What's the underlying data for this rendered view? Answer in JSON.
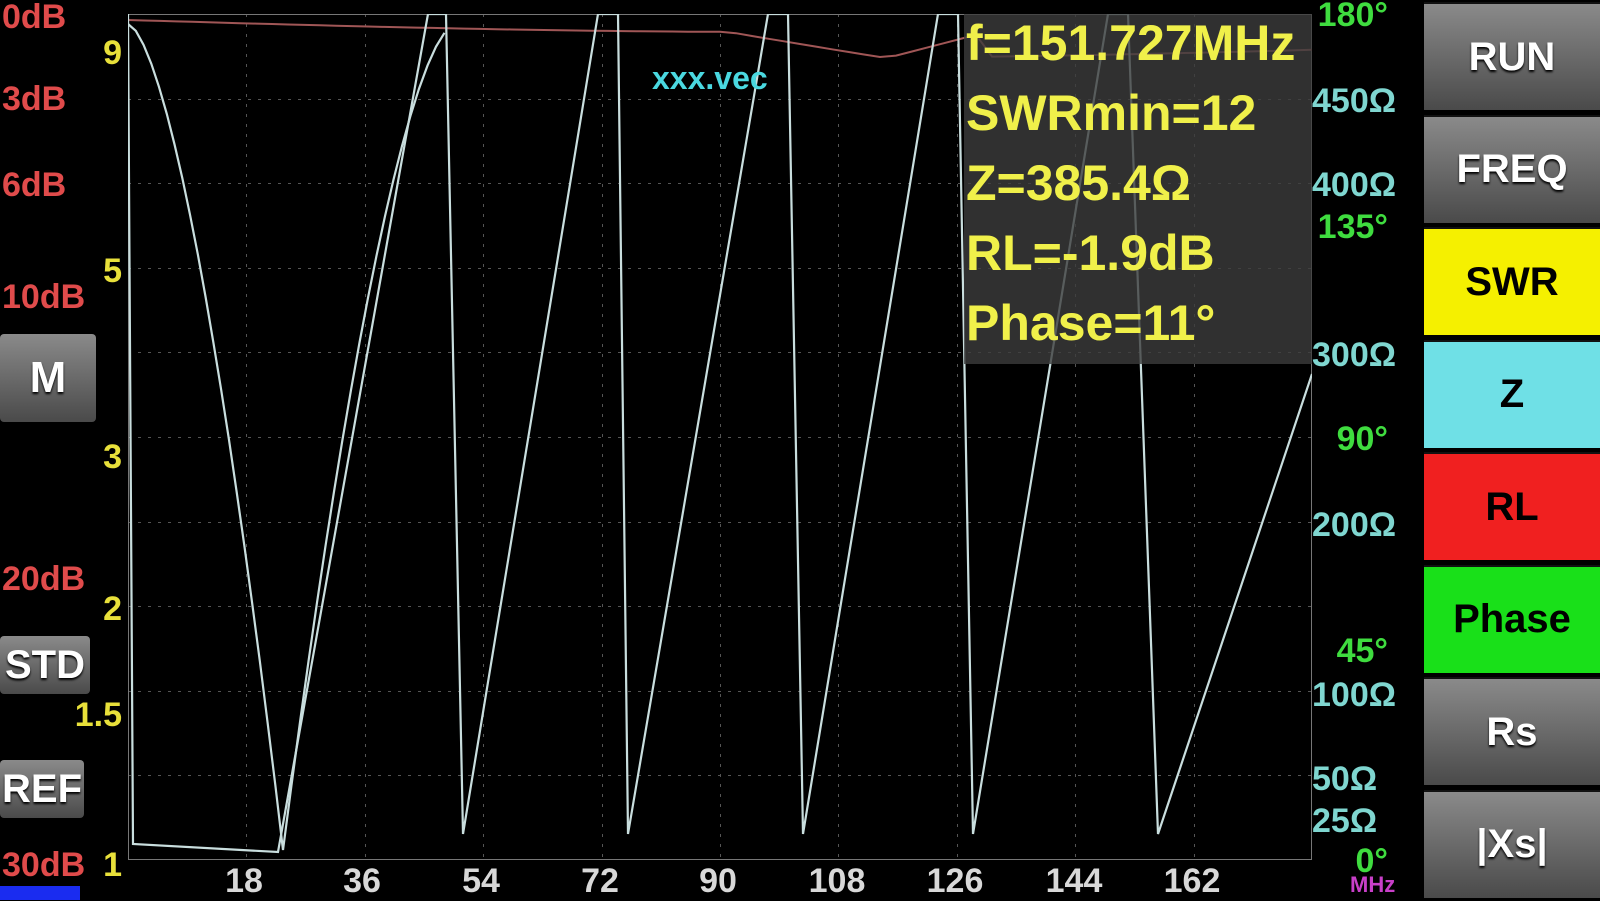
{
  "filename": "xxx.vec",
  "readout": {
    "freq": "f=151.727MHz",
    "swrmin": "SWRmin=12",
    "z": "Z=385.4Ω",
    "rl": "RL=-1.9dB",
    "phase": "Phase=11°"
  },
  "rl_axis": [
    "0dB",
    "3dB",
    "6dB",
    "10dB",
    "20dB",
    "30dB"
  ],
  "swr_axis": [
    "9",
    "5",
    "3",
    "2",
    "1.5",
    "1"
  ],
  "z_axis": [
    "450Ω",
    "400Ω",
    "300Ω",
    "200Ω",
    "100Ω",
    "50Ω",
    "25Ω"
  ],
  "phase_axis": [
    "180°",
    "135°",
    "90°",
    "45°",
    "0°"
  ],
  "x_axis": [
    "18",
    "36",
    "54",
    "72",
    "90",
    "108",
    "126",
    "144",
    "162"
  ],
  "x_unit": "MHz",
  "left_buttons": {
    "m": "M",
    "std": "STD",
    "ref": "REF"
  },
  "side_buttons": [
    {
      "label": "RUN",
      "color": "gray"
    },
    {
      "label": "FREQ",
      "color": "gray"
    },
    {
      "label": "SWR",
      "color": "#f5f000"
    },
    {
      "label": "Z",
      "color": "#6fe0e6"
    },
    {
      "label": "RL",
      "color": "#f02020"
    },
    {
      "label": "Phase",
      "color": "#19e019"
    },
    {
      "label": "Rs",
      "color": "gray"
    },
    {
      "label": "|Xs|",
      "color": "gray"
    }
  ],
  "colors": {
    "swr_trace": "#c9dede",
    "rl_trace": "#a05656",
    "grid": "#555555"
  }
}
